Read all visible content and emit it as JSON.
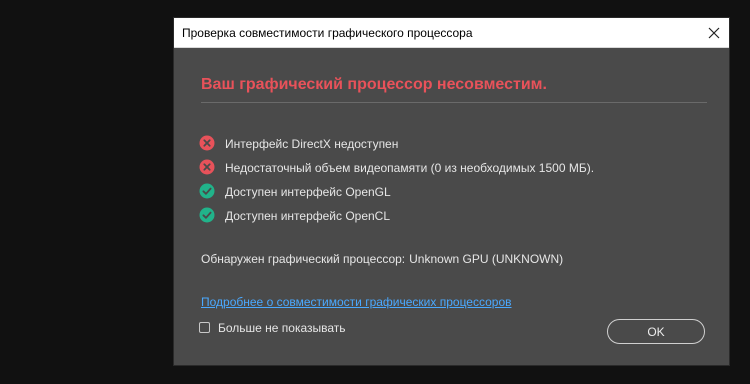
{
  "dialog": {
    "title": "Проверка совместимости графического процессора",
    "headline": "Ваш графический процессор несовместим.",
    "checks": [
      {
        "label": "Интерфейс DirectX недоступен",
        "status": "fail",
        "icon": "error-circle-icon"
      },
      {
        "label": "Недостаточный объем видеопамяти (0 из необходимых 1500 МБ).",
        "status": "fail",
        "icon": "error-circle-icon"
      },
      {
        "label": "Доступен интерфейс OpenGL",
        "status": "ok",
        "icon": "success-circle-icon"
      },
      {
        "label": "Доступен интерфейс OpenCL",
        "status": "ok",
        "icon": "success-circle-icon"
      }
    ],
    "gpu_info": {
      "label": "Обнаружен графический процессор:",
      "value": "Unknown GPU (UNKNOWN)"
    },
    "more_link": "Подробнее о совместимости графических процессоров",
    "dont_show_label": "Больше не показывать",
    "dont_show_checked": false,
    "ok_label": "OK"
  },
  "colors": {
    "background": "#111111",
    "dialog_bg": "#4a4a4a",
    "headline": "#e8525a",
    "fail_icon": "#e8525a",
    "ok_icon": "#21b38a",
    "link": "#4aa9ff"
  }
}
